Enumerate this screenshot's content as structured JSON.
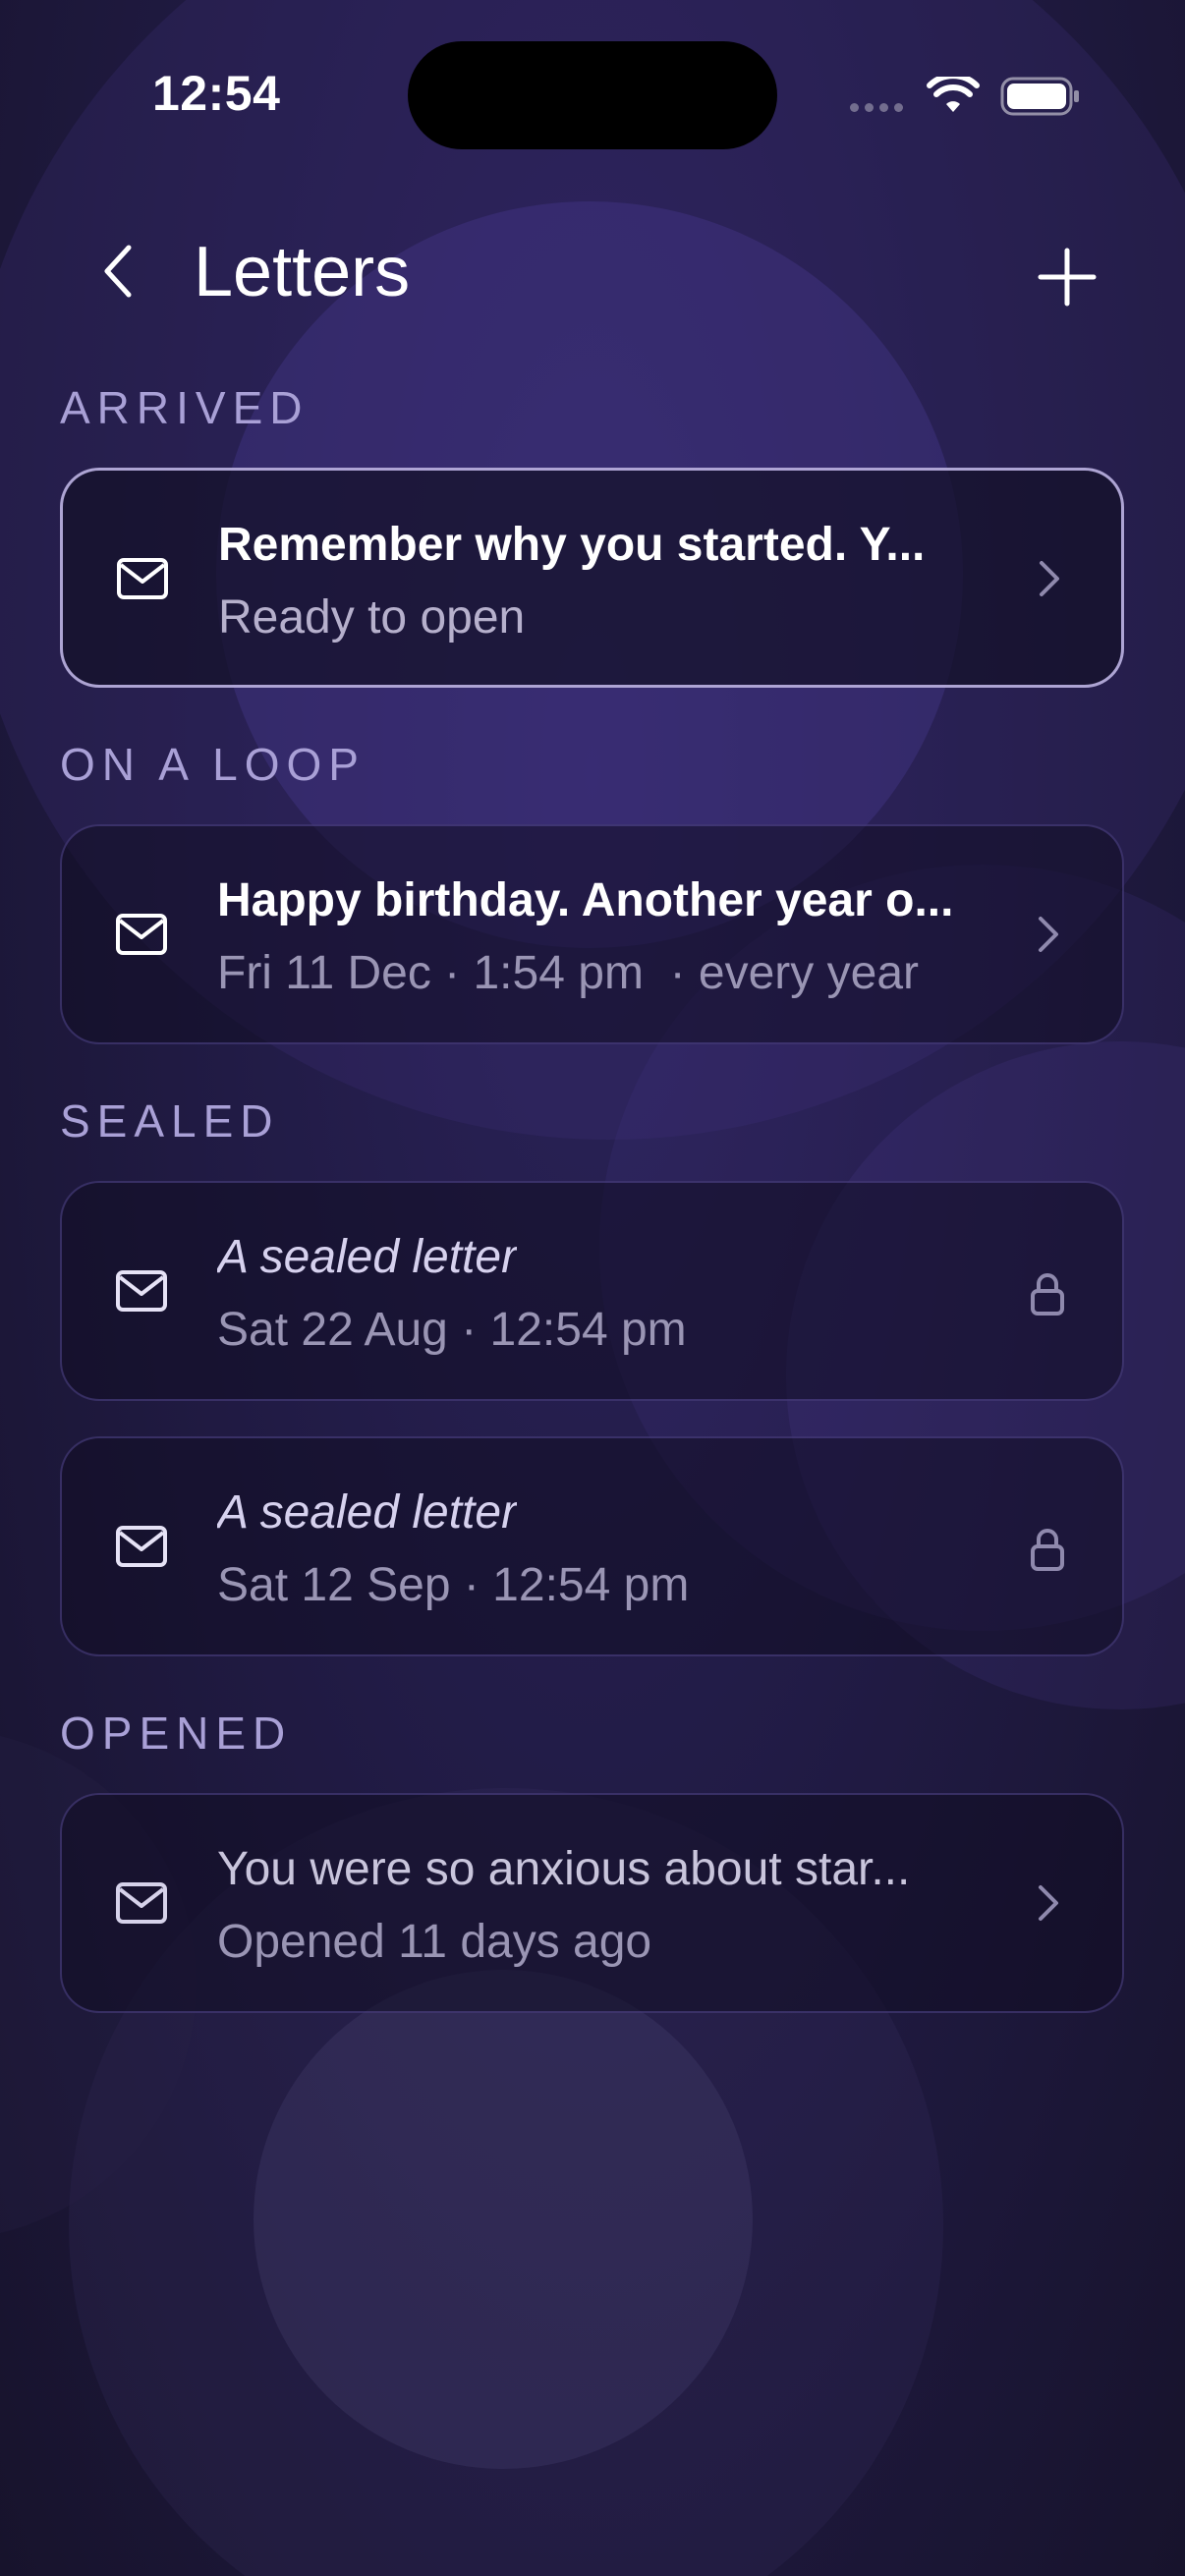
{
  "status_bar": {
    "time": "12:54"
  },
  "nav": {
    "title": "Letters",
    "back_icon": "chevron-left-icon",
    "add_icon": "plus-icon"
  },
  "sections": {
    "arrived": {
      "header": "ARRIVED",
      "items": [
        {
          "title": "Remember why you started. Y...",
          "subtitle": "Ready to open",
          "icon": "envelope-icon",
          "trailing": "chevron-right-icon"
        }
      ]
    },
    "loop": {
      "header": "ON A LOOP",
      "items": [
        {
          "title": "Happy birthday. Another year o...",
          "subtitle": "Fri 11 Dec · 1:54 pm  · every year",
          "icon": "envelope-icon",
          "trailing": "chevron-right-icon"
        }
      ]
    },
    "sealed": {
      "header": "SEALED",
      "items": [
        {
          "title": "A sealed letter",
          "subtitle": "Sat 22 Aug · 12:54 pm",
          "icon": "envelope-icon",
          "trailing": "lock-icon"
        },
        {
          "title": "A sealed letter",
          "subtitle": "Sat 12 Sep · 12:54 pm",
          "icon": "envelope-icon",
          "trailing": "lock-icon"
        }
      ]
    },
    "opened": {
      "header": "OPENED",
      "items": [
        {
          "title": "You were so anxious about star...",
          "subtitle": "Opened 11 days ago",
          "icon": "envelope-icon",
          "trailing": "chevron-right-icon"
        }
      ]
    }
  },
  "colors": {
    "background": "#1d1838",
    "section_header": "#a9a0d6",
    "card_border_highlight": "#c8bef0"
  }
}
